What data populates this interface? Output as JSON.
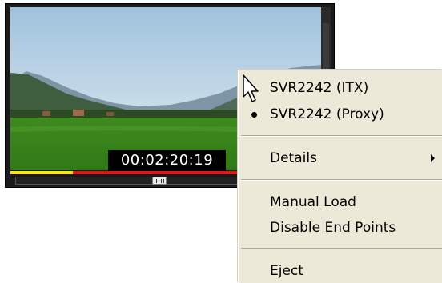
{
  "player": {
    "timecode": "00:02:20:19",
    "playback_progress": 0.2,
    "accent_colors": {
      "played": "#ffe316",
      "remaining": "#e0141a"
    }
  },
  "context_menu": {
    "items": [
      {
        "label": "SVR2242 (ITX)",
        "selected": false
      },
      {
        "label": "SVR2242 (Proxy)",
        "selected": true
      },
      {
        "label": "Details",
        "has_submenu": true
      },
      {
        "label": "Manual Load"
      },
      {
        "label": "Disable End Points"
      },
      {
        "label": "Eject"
      }
    ]
  },
  "icons": {
    "cursor": "arrow-cursor-icon",
    "radio": "radio-bullet-icon",
    "submenu": "submenu-arrow-icon"
  }
}
